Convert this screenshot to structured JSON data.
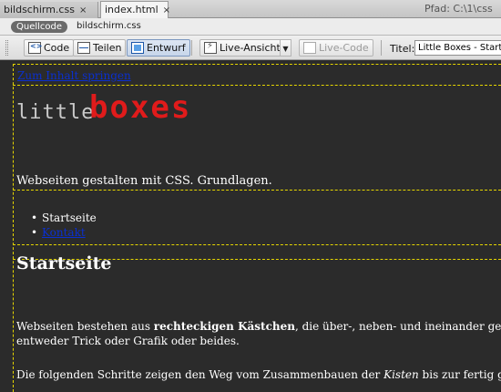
{
  "tabs": [
    {
      "label": "bildschirm.css",
      "close": "×",
      "active": false
    },
    {
      "label": "index.html",
      "close": "×",
      "active": true
    }
  ],
  "path_label": "Pfad:  C:\\1\\css",
  "source_bar": {
    "pill": "Quellcode",
    "file": "bildschirm.css"
  },
  "toolbar": {
    "code": "Code",
    "split": "Teilen",
    "design": "Entwurf",
    "live_view": "Live-Ansicht",
    "live_code": "Live-Code",
    "dropdown_glyph": "▼",
    "title_label": "Titel:",
    "title_value": "Little Boxes - Start"
  },
  "page": {
    "skip_link": "Zum Inhalt springen",
    "logo_small": "little",
    "logo_big": "boxes",
    "tagline": "Webseiten gestalten mit CSS. Grundlagen.",
    "nav": [
      "Startseite",
      "Kontakt"
    ],
    "heading": "Startseite",
    "para1_a": "Webseiten bestehen aus ",
    "para1_b": "rechteckigen Kästchen",
    "para1_c": ", die über-, neben- und ineinander gest",
    "para1_line2": "entweder Trick oder Grafik oder beides.",
    "para2_a": "Die folgenden Schritte zeigen den Weg vom Zusammenbauen der ",
    "para2_b": "Kisten",
    "para2_c": " bis zur fertig ge"
  },
  "colors": {
    "guide": "#e6d600",
    "logo_red": "#e01b1b",
    "link": "#0a2fd0",
    "canvas": "#2b2b2b"
  }
}
